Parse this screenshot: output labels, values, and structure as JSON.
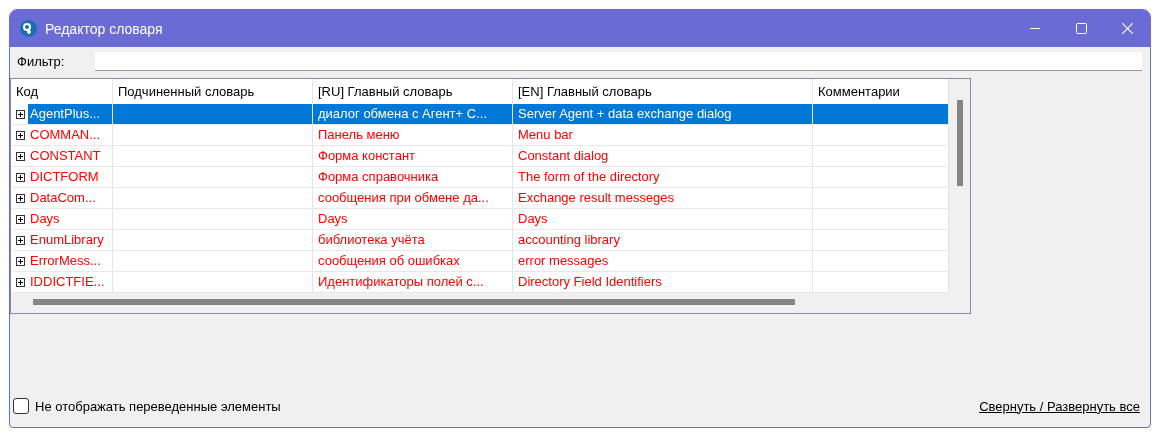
{
  "window": {
    "title": "Редактор словаря"
  },
  "filter": {
    "label": "Фильтр:"
  },
  "table": {
    "columns": [
      "Код",
      "Подчиненный словарь",
      "[RU] Главный словарь",
      "[EN] Главный словарь",
      "Комментарии"
    ],
    "rows": [
      {
        "code": "AgentPlus...",
        "ru": "диалог обмена с Агент+ С...",
        "en": "Server Agent + data exchange dialog",
        "selected": true,
        "expanded": false,
        "untranslated": true
      },
      {
        "code": "COMMAN...",
        "ru": "Панель меню",
        "en": "Menu bar",
        "selected": false,
        "expanded": false,
        "untranslated": true
      },
      {
        "code": "CONSTANT",
        "ru": "Форма констант",
        "en": "Constant dialog",
        "selected": false,
        "expanded": false,
        "untranslated": true
      },
      {
        "code": "DICTFORM",
        "ru": "Форма справочника",
        "en": "The form of the directory",
        "selected": false,
        "expanded": false,
        "untranslated": true
      },
      {
        "code": "DataCom...",
        "ru": "сообщения при обмене да...",
        "en": "Exchange result messeges",
        "selected": false,
        "expanded": false,
        "untranslated": true
      },
      {
        "code": "Days",
        "ru": "Days",
        "en": "Days",
        "selected": false,
        "expanded": false,
        "untranslated": true
      },
      {
        "code": "EnumLibrary",
        "ru": "библиотека учёта",
        "en": "accounting library",
        "selected": false,
        "expanded": false,
        "untranslated": true
      },
      {
        "code": "ErrorMess...",
        "ru": "сообщения об ошибках",
        "en": "error messages",
        "selected": false,
        "expanded": false,
        "untranslated": true
      },
      {
        "code": "IDDICTFIE...",
        "ru": "Идентификаторы полей с...",
        "en": "Directory Field Identifiers",
        "selected": false,
        "expanded": false,
        "untranslated": true
      }
    ]
  },
  "hide_translated": {
    "label": "Не отображать переведенные элементы",
    "checked": false
  },
  "collapse_link": "Свернуть / Развернуть все"
}
